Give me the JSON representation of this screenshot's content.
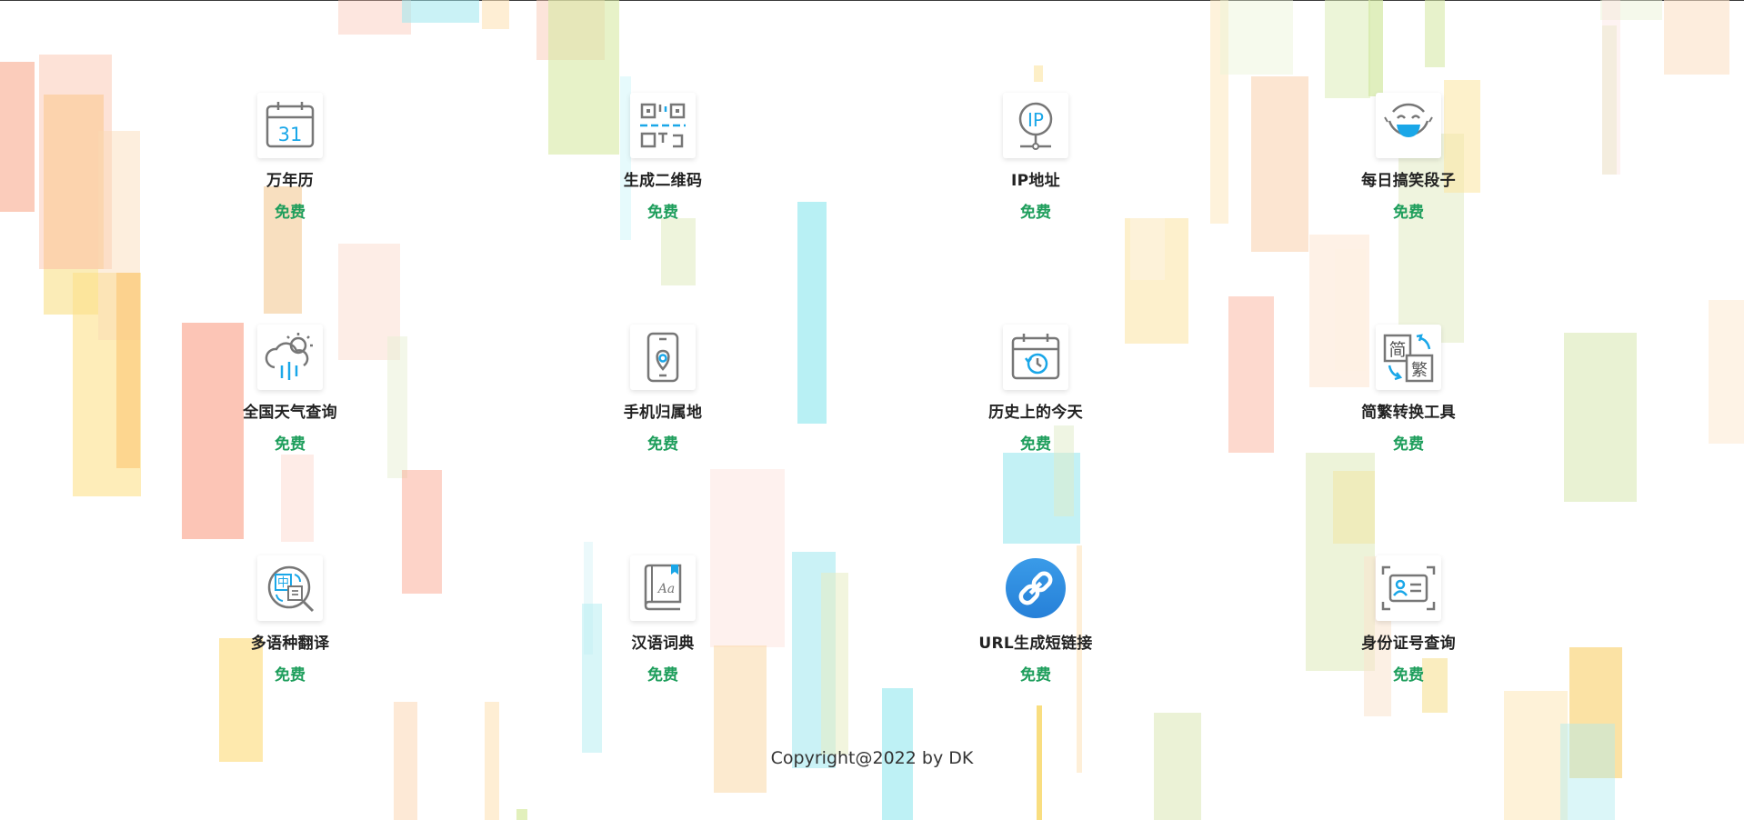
{
  "tools": [
    {
      "name": "万年历",
      "price": "免费",
      "icon": "calendar-31-icon",
      "calendar_day": "31"
    },
    {
      "name": "生成二维码",
      "price": "免费",
      "icon": "qr-code-icon"
    },
    {
      "name": "IP地址",
      "price": "免费",
      "icon": "ip-pin-icon",
      "icon_text": "IP"
    },
    {
      "name": "每日搞笑段子",
      "price": "免费",
      "icon": "laughing-face-icon"
    },
    {
      "name": "全国天气查询",
      "price": "免费",
      "icon": "weather-icon"
    },
    {
      "name": "手机归属地",
      "price": "免费",
      "icon": "phone-location-icon"
    },
    {
      "name": "历史上的今天",
      "price": "免费",
      "icon": "calendar-history-icon"
    },
    {
      "name": "简繁转换工具",
      "price": "免费",
      "icon": "simplified-traditional-icon",
      "icon_text_a": "简",
      "icon_text_b": "繁"
    },
    {
      "name": "多语种翻译",
      "price": "免费",
      "icon": "translate-icon",
      "icon_text": "中"
    },
    {
      "name": "汉语词典",
      "price": "免费",
      "icon": "dictionary-icon",
      "icon_text": "Aa"
    },
    {
      "name": "URL生成短链接",
      "price": "免费",
      "icon": "link-icon"
    },
    {
      "name": "身份证号查询",
      "price": "免费",
      "icon": "id-card-icon"
    }
  ],
  "colors": {
    "price": "#1e9e5c",
    "icon_gray": "#777777",
    "icon_accent": "#1aa7e8",
    "link_blue": "#2b8fe0"
  },
  "footer": {
    "copyright": "Copyright@2022 by DK"
  }
}
